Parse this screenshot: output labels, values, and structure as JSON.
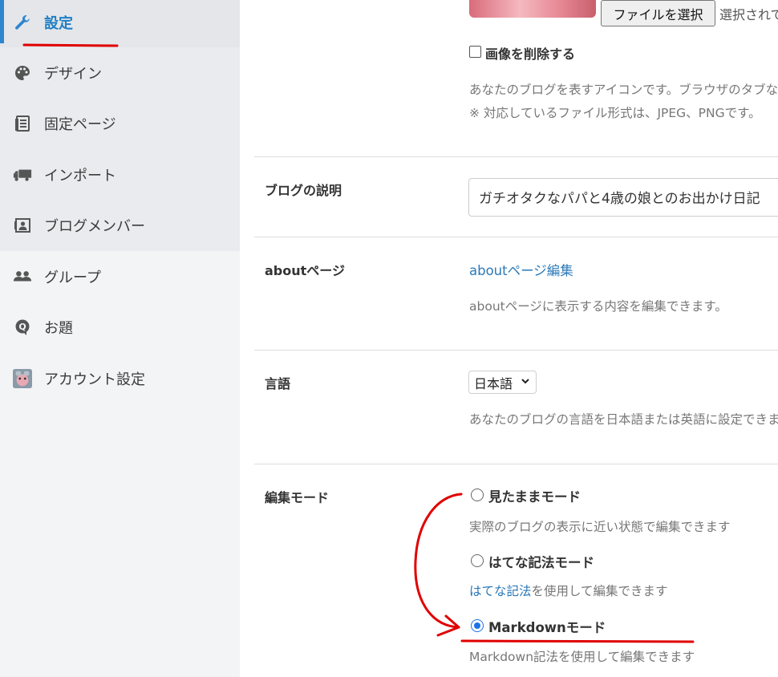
{
  "sidebar": {
    "items": [
      {
        "label": "設定",
        "icon": "wrench-icon",
        "active": true
      },
      {
        "label": "デザイン",
        "icon": "palette-icon"
      },
      {
        "label": "固定ページ",
        "icon": "document-icon"
      },
      {
        "label": "インポート",
        "icon": "truck-icon"
      },
      {
        "label": "ブログメンバー",
        "icon": "member-card-icon"
      },
      {
        "label": "グループ",
        "icon": "users-icon"
      },
      {
        "label": "お題",
        "icon": "question-bubble-icon"
      },
      {
        "label": "アカウント設定",
        "icon": "avatar-icon"
      }
    ]
  },
  "icon_section": {
    "file_button": "ファイルを選択",
    "file_status": "選択されていません",
    "delete_checkbox": "画像を削除する",
    "desc_line1": "あなたのブログを表すアイコンです。ブラウザのタブなどに表示されます。",
    "desc_line2": "※ 対応しているファイル形式は、JPEG、PNGです。"
  },
  "description_section": {
    "label": "ブログの説明",
    "value": "ガチオタクなパパと4歳の娘とのお出かけ日記"
  },
  "about_section": {
    "label": "aboutページ",
    "link": "aboutページ編集",
    "desc": "aboutページに表示する内容を編集できます。"
  },
  "language_section": {
    "label": "言語",
    "selected": "日本語",
    "desc": "あなたのブログの言語を日本語または英語に設定できます。"
  },
  "edit_mode_section": {
    "label": "編集モード",
    "options": [
      {
        "label": "見たままモード",
        "desc": "実際のブログの表示に近い状態で編集できます",
        "checked": false
      },
      {
        "label": "はてな記法モード",
        "desc_link": "はてな記法",
        "desc": "を使用して編集できます",
        "checked": false
      },
      {
        "label": "Markdownモード",
        "desc": "Markdown記法を使用して編集できます",
        "checked": true
      }
    ]
  },
  "colors": {
    "accent": "#2f86cf",
    "link": "#2b79b8",
    "annotation": "#e00000"
  }
}
